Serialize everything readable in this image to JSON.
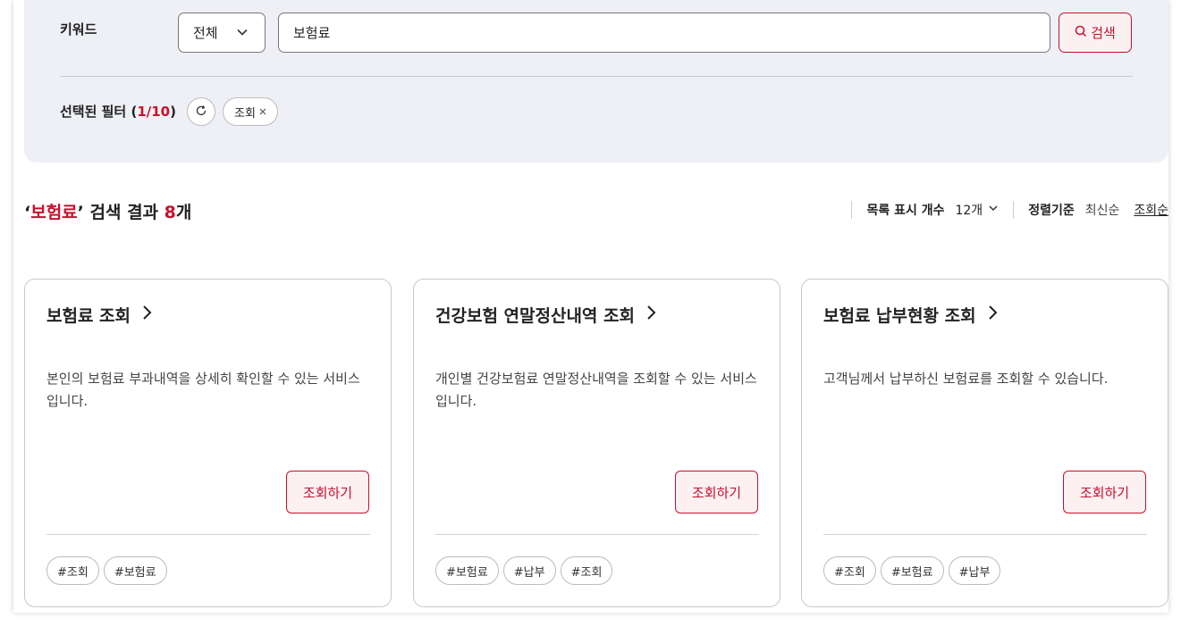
{
  "filter": {
    "keyword_label": "키워드",
    "scope_value": "전체",
    "search_value": "보험료",
    "search_button": "검색",
    "selected_label_prefix": "선택된 필터 (",
    "selected_count": "1/10",
    "selected_label_suffix": ")",
    "chips": [
      "조회"
    ]
  },
  "results": {
    "quote_open": "‘",
    "keyword": "보험료",
    "quote_close": "’",
    "mid_text": " 검색 결과 ",
    "count": "8",
    "count_unit": "개"
  },
  "toolbar": {
    "list_count_label": "목록 표시 개수",
    "list_count_value": "12개",
    "sort_label": "정렬기준",
    "sort_options": [
      "최신순",
      "조회순"
    ]
  },
  "cards": [
    {
      "title": "보험료 조회",
      "description": "본인의 보험료 부과내역을 상세히 확인할 수 있는 서비스 입니다.",
      "button": "조회하기",
      "tags": [
        "#조회",
        "#보험료"
      ]
    },
    {
      "title": "건강보험 연말정산내역 조회",
      "description": "개인별 건강보험료 연말정산내역을 조회할 수 있는 서비스입니다.",
      "button": "조회하기",
      "tags": [
        "#보험료",
        "#납부",
        "#조회"
      ]
    },
    {
      "title": "보험료 납부현황 조회",
      "description": "고객님께서 납부하신 보험료를 조회할 수 있습니다.",
      "button": "조회하기",
      "tags": [
        "#조회",
        "#보험료",
        "#납부"
      ]
    }
  ],
  "colors": {
    "accent": "#c8102e",
    "panel_bg": "#eef0f5",
    "button_bg": "#fdf0f1"
  }
}
